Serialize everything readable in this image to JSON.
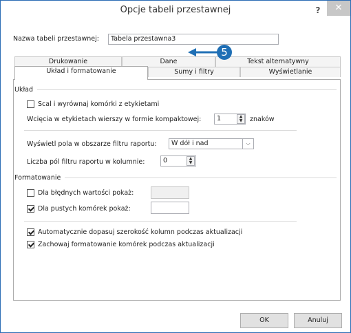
{
  "dialog": {
    "title": "Opcje tabeli przestawnej",
    "help_label": "?",
    "close_label": "✕"
  },
  "name_field": {
    "label": "Nazwa tabeli przestawnej:",
    "value": "Tabela przestawna3"
  },
  "tabs": {
    "row1": [
      {
        "label": "Drukowanie"
      },
      {
        "label": "Dane"
      },
      {
        "label": "Tekst alternatywny"
      }
    ],
    "row2": [
      {
        "label": "Układ i formatowanie",
        "active": true
      },
      {
        "label": "Sumy i filtry"
      },
      {
        "label": "Wyświetlanie"
      }
    ]
  },
  "callout": {
    "number": "5"
  },
  "layout_section": {
    "title": "Układ",
    "merge_label": "Scal i wyrównaj komórki z etykietami",
    "merge_checked": false,
    "indent_label": "Wcięcia w etykietach wierszy w formie kompaktowej:",
    "indent_value": "1",
    "indent_unit": "znaków",
    "filter_fields_label": "Wyświetl pola w obszarze filtru raportu:",
    "filter_fields_value": "W dół i nad",
    "filter_count_label": "Liczba pól filtru raportu w kolumnie:",
    "filter_count_value": "0"
  },
  "format_section": {
    "title": "Formatowanie",
    "errors_label": "Dla błędnych wartości pokaż:",
    "errors_checked": false,
    "errors_value": "",
    "empty_label": "Dla pustych komórek pokaż:",
    "empty_checked": true,
    "empty_value": "",
    "autofit_label": "Automatycznie dopasuj szerokość kolumn podczas aktualizacji",
    "autofit_checked": true,
    "preserve_label": "Zachowaj formatowanie komórek podczas aktualizacji",
    "preserve_checked": true
  },
  "buttons": {
    "ok": "OK",
    "cancel": "Anuluj"
  },
  "colors": {
    "accent": "#1f6fb5",
    "border": "#2b6cb5"
  },
  "icons": {
    "spin_up": "▲",
    "spin_down": "▼",
    "dropdown": "⌵"
  }
}
